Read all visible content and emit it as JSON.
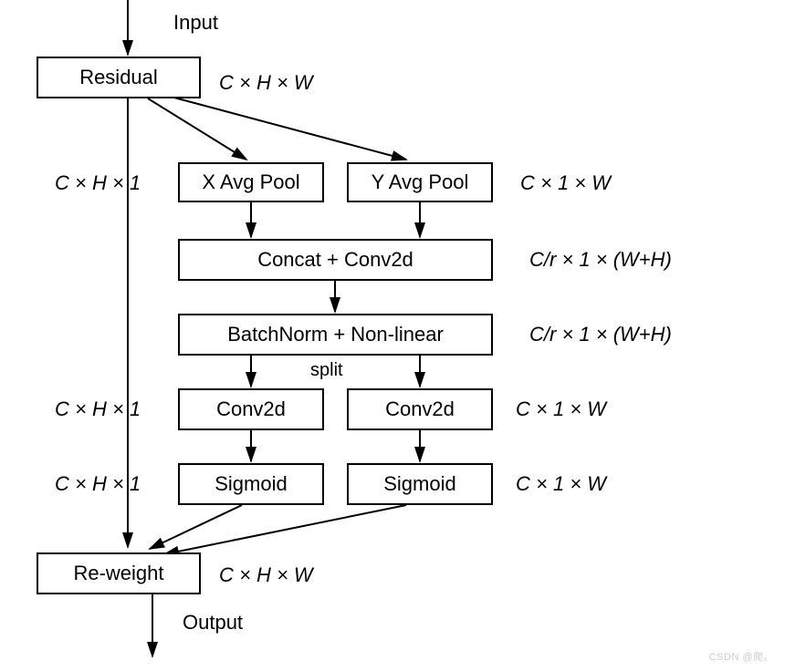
{
  "labels": {
    "input": "Input",
    "output": "Output",
    "split": "split"
  },
  "boxes": {
    "residual": "Residual",
    "xavgpool": "X Avg Pool",
    "yavgpool": "Y Avg Pool",
    "concat": "Concat + Conv2d",
    "batchnorm": "BatchNorm + Non-linear",
    "conv2d_left": "Conv2d",
    "conv2d_right": "Conv2d",
    "sigmoid_left": "Sigmoid",
    "sigmoid_right": "Sigmoid",
    "reweight": "Re-weight"
  },
  "dims": {
    "residual": "C × H × W",
    "xavg_left": "C × H × 1",
    "yavg_right": "C × 1 × W",
    "concat_right": "C/r × 1 × (W+H)",
    "bn_right": "C/r × 1 × (W+H)",
    "conv_left": "C × H × 1",
    "conv_right": "C × 1 × W",
    "sig_left": "C × H × 1",
    "sig_right": "C × 1 × W",
    "reweight": "C × H × W"
  },
  "watermark": "CSDN @爬。"
}
